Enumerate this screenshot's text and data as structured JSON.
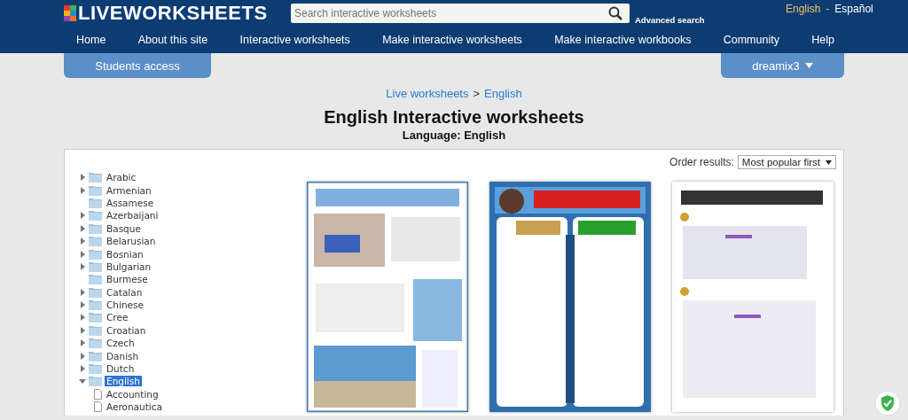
{
  "header": {
    "logo": "LIVEWORKSHEETS",
    "search": {
      "placeholder": "Search interactive worksheets"
    },
    "advanced_search": "Advanced search",
    "languages": [
      {
        "label": "English",
        "selected": true
      },
      {
        "label": "Español",
        "selected": false
      }
    ],
    "language_separator": "-"
  },
  "nav": [
    "Home",
    "About this site",
    "Interactive worksheets",
    "Make interactive worksheets",
    "Make interactive workbooks",
    "Community",
    "Help"
  ],
  "students_access": "Students access",
  "user_menu": "dreamix3",
  "breadcrumb": [
    "Live worksheets",
    "English"
  ],
  "breadcrumb_separator": ">",
  "title": "English Interactive worksheets",
  "subtitle": "Language: English",
  "order": {
    "label": "Order results:",
    "value": "Most popular first"
  },
  "tree": [
    {
      "kind": "folder",
      "label": "Arabic",
      "expanded": false,
      "selected": false
    },
    {
      "kind": "folder",
      "label": "Armenian",
      "expanded": false,
      "selected": false
    },
    {
      "kind": "folder",
      "label": "Assamese",
      "selected": false
    },
    {
      "kind": "folder",
      "label": "Azerbaijani",
      "expanded": false,
      "selected": false
    },
    {
      "kind": "folder",
      "label": "Basque",
      "expanded": false,
      "selected": false
    },
    {
      "kind": "folder",
      "label": "Belarusian",
      "expanded": false,
      "selected": false
    },
    {
      "kind": "folder",
      "label": "Bosnian",
      "expanded": false,
      "selected": false
    },
    {
      "kind": "folder",
      "label": "Bulgarian",
      "expanded": false,
      "selected": false
    },
    {
      "kind": "folder",
      "label": "Burmese",
      "selected": false
    },
    {
      "kind": "folder",
      "label": "Catalan",
      "expanded": false,
      "selected": false
    },
    {
      "kind": "folder",
      "label": "Chinese",
      "expanded": false,
      "selected": false
    },
    {
      "kind": "folder",
      "label": "Cree",
      "expanded": false,
      "selected": false
    },
    {
      "kind": "folder",
      "label": "Croatian",
      "expanded": false,
      "selected": false
    },
    {
      "kind": "folder",
      "label": "Czech",
      "expanded": false,
      "selected": false
    },
    {
      "kind": "folder",
      "label": "Danish",
      "expanded": false,
      "selected": false
    },
    {
      "kind": "folder",
      "label": "Dutch",
      "expanded": false,
      "selected": false
    },
    {
      "kind": "folder",
      "label": "English",
      "expanded": true,
      "selected": true,
      "children": [
        {
          "kind": "document",
          "label": "Accounting",
          "selected": false
        },
        {
          "kind": "document",
          "label": "Aeronautica",
          "selected": false
        }
      ]
    }
  ],
  "worksheets": [
    {
      "kind": "picture"
    },
    {
      "kind": "picture"
    },
    {
      "kind": "picture"
    }
  ]
}
